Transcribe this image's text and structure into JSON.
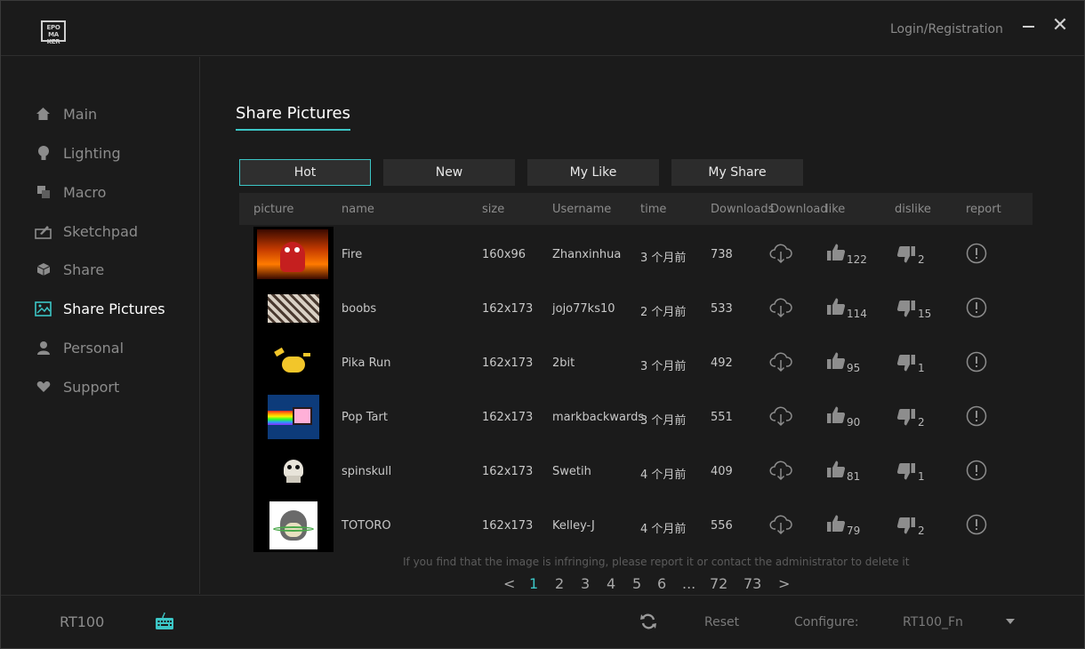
{
  "app": {
    "logo_text": "EPOMAKER",
    "login_label": "Login/Registration"
  },
  "sidebar": {
    "items": [
      {
        "label": "Main",
        "icon": "home-icon"
      },
      {
        "label": "Lighting",
        "icon": "bulb-icon"
      },
      {
        "label": "Macro",
        "icon": "macro-icon"
      },
      {
        "label": "Sketchpad",
        "icon": "sketchpad-icon"
      },
      {
        "label": "Share",
        "icon": "cube-icon"
      },
      {
        "label": "Share Pictures",
        "icon": "picture-icon",
        "active": true
      },
      {
        "label": "Personal",
        "icon": "person-icon"
      },
      {
        "label": "Support",
        "icon": "heart-icon"
      }
    ]
  },
  "main": {
    "title": "Share Pictures",
    "tabs": [
      "Hot",
      "New",
      "My Like",
      "My Share"
    ],
    "active_tab": "Hot",
    "columns": [
      "picture",
      "name",
      "size",
      "Username",
      "time",
      "Downloads",
      "Download",
      "like",
      "dislike",
      "report"
    ],
    "rows": [
      {
        "name": "Fire",
        "size": "160x96",
        "username": "Zhanxinhua",
        "time": "3 个月前",
        "downloads": "738",
        "likes": "122",
        "dislikes": "2"
      },
      {
        "name": "boobs",
        "size": "162x173",
        "username": "jojo77ks10",
        "time": "2 个月前",
        "downloads": "533",
        "likes": "114",
        "dislikes": "15"
      },
      {
        "name": "Pika Run",
        "size": "162x173",
        "username": "2bit",
        "time": "3 个月前",
        "downloads": "492",
        "likes": "95",
        "dislikes": "1"
      },
      {
        "name": "Pop Tart",
        "size": "162x173",
        "username": "markbackwards",
        "time": "3 个月前",
        "downloads": "551",
        "likes": "90",
        "dislikes": "2"
      },
      {
        "name": "spinskull",
        "size": "162x173",
        "username": "Swetih",
        "time": "4 个月前",
        "downloads": "409",
        "likes": "81",
        "dislikes": "1"
      },
      {
        "name": "TOTORO",
        "size": "162x173",
        "username": "Kelley-J",
        "time": "4 个月前",
        "downloads": "556",
        "likes": "79",
        "dislikes": "2"
      }
    ],
    "notice": "If you find that the image is infringing, please report it or contact the administrator to delete it",
    "pagination": {
      "prev": "<",
      "pages": [
        "1",
        "2",
        "3",
        "4",
        "5",
        "6",
        "...",
        "72",
        "73"
      ],
      "next": ">",
      "current": "1"
    }
  },
  "footer": {
    "device": "RT100",
    "reset_label": "Reset",
    "configure_label": "Configure:",
    "configure_value": "RT100_Fn"
  },
  "colors": {
    "accent": "#3cc6c6",
    "background": "#1b1b1b",
    "panel": "#2c2c2c"
  }
}
